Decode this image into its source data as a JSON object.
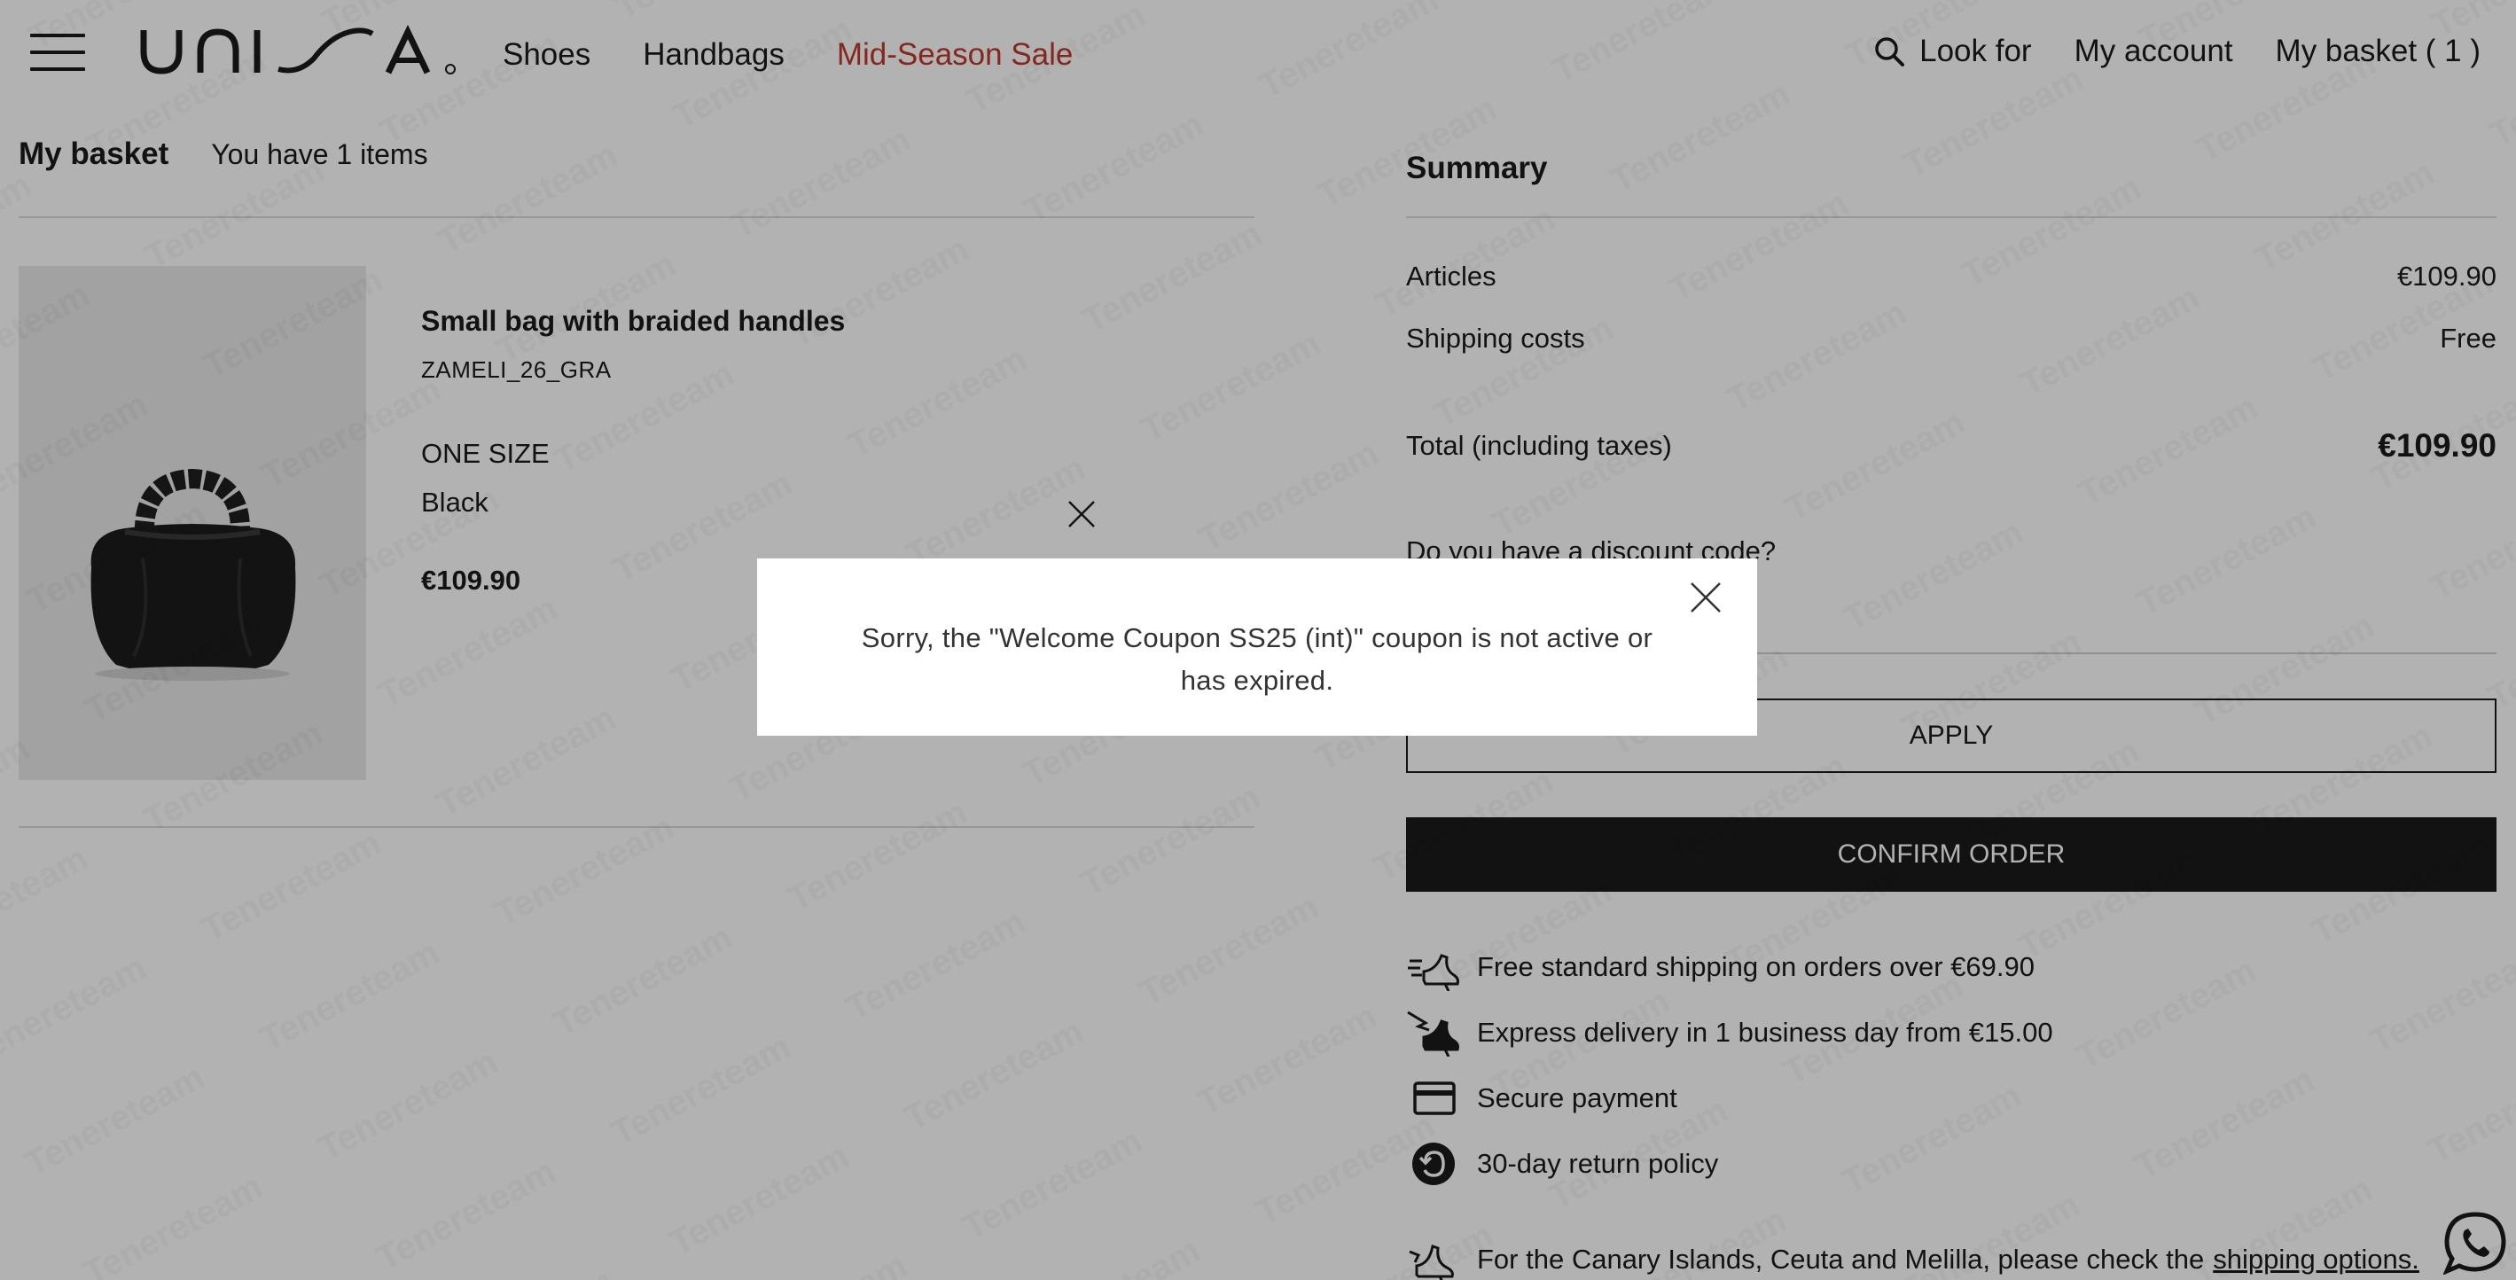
{
  "header": {
    "logo_text": "UNISA",
    "nav": [
      {
        "label": "Shoes"
      },
      {
        "label": "Handbags"
      },
      {
        "label": "Mid-Season Sale"
      }
    ],
    "search_label": "Look for",
    "account_label": "My account",
    "basket_label": "My basket ( 1 )"
  },
  "basket": {
    "title": "My basket",
    "count_text": "You have 1 items",
    "item": {
      "name": "Small bag with braided handles",
      "sku": "ZAMELI_26_GRA",
      "size": "ONE SIZE",
      "color": "Black",
      "price": "€109.90",
      "image_icon": "black-handbag-image"
    }
  },
  "summary": {
    "title": "Summary",
    "articles_label": "Articles",
    "articles_value": "€109.90",
    "shipping_label": "Shipping costs",
    "shipping_value": "Free",
    "total_label": "Total (including taxes)",
    "total_value": "€109.90",
    "discount_label": "Do you have a discount code?",
    "discount_value": "",
    "apply_label": "APPLY",
    "confirm_label": "CONFIRM ORDER",
    "info": [
      {
        "icon": "shipping-shoe-icon",
        "text": "Free standard shipping on orders over €69.90"
      },
      {
        "icon": "express-shoe-icon",
        "text": "Express delivery in 1 business day from €15.00"
      },
      {
        "icon": "credit-card-icon",
        "text": "Secure payment"
      },
      {
        "icon": "return-icon",
        "text": "30-day return policy"
      }
    ],
    "canary_text": "For the Canary Islands, Ceuta and Melilla, please check the",
    "canary_link": "shipping options."
  },
  "modal": {
    "message": "Sorry, the \"Welcome Coupon SS25 (int)\" coupon is not active or has expired."
  },
  "colors": {
    "sale": "#c0392b",
    "dark": "#1a1a1a",
    "overlay": "rgba(0,0,0,0.30)"
  }
}
